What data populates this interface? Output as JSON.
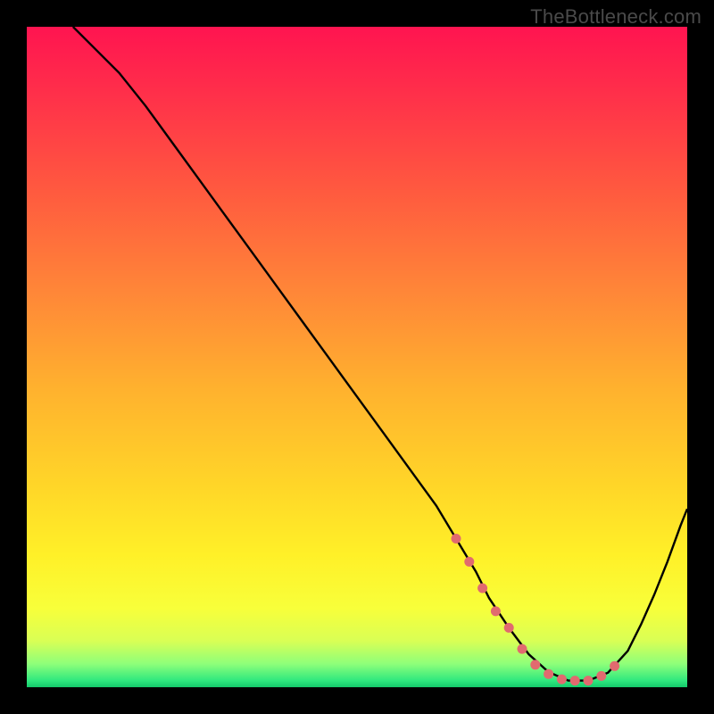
{
  "watermark": "TheBottleneck.com",
  "chart_data": {
    "type": "line",
    "title": "",
    "xlabel": "",
    "ylabel": "",
    "xlim": [
      0,
      100
    ],
    "ylim": [
      0,
      100
    ],
    "series": [
      {
        "name": "curve",
        "color": "#000000",
        "x": [
          7,
          10,
          14,
          18,
          22,
          26,
          30,
          34,
          38,
          42,
          46,
          50,
          54,
          58,
          62,
          65,
          68,
          70,
          73,
          76,
          79,
          82,
          85,
          88,
          91,
          93,
          95,
          97,
          99,
          100
        ],
        "y": [
          100,
          97,
          93,
          88,
          82.5,
          77,
          71.5,
          66,
          60.5,
          55,
          49.5,
          44,
          38.5,
          33,
          27.5,
          22.5,
          17.5,
          13.5,
          9,
          5,
          2.3,
          1,
          1,
          2.2,
          5.5,
          9.5,
          14,
          19,
          24.5,
          27
        ]
      },
      {
        "name": "highlight",
        "color": "#e16a6f",
        "style": "dotted-thick",
        "x": [
          65,
          67,
          69,
          71,
          73,
          75,
          77,
          79,
          81,
          83,
          85,
          87,
          89
        ],
        "y": [
          22.5,
          19,
          15,
          11.5,
          9,
          5.8,
          3.4,
          2,
          1.2,
          1,
          1,
          1.7,
          3.2
        ]
      }
    ],
    "background_gradient": {
      "stops": [
        {
          "offset": 0.0,
          "color": "#ff1450"
        },
        {
          "offset": 0.1,
          "color": "#ff2f4a"
        },
        {
          "offset": 0.25,
          "color": "#ff5a3f"
        },
        {
          "offset": 0.4,
          "color": "#ff8638"
        },
        {
          "offset": 0.55,
          "color": "#ffb22e"
        },
        {
          "offset": 0.7,
          "color": "#ffd728"
        },
        {
          "offset": 0.8,
          "color": "#fff028"
        },
        {
          "offset": 0.88,
          "color": "#f8ff3a"
        },
        {
          "offset": 0.93,
          "color": "#d9ff55"
        },
        {
          "offset": 0.965,
          "color": "#8dff7a"
        },
        {
          "offset": 0.99,
          "color": "#2fe87e"
        },
        {
          "offset": 1.0,
          "color": "#14c96b"
        }
      ]
    }
  }
}
